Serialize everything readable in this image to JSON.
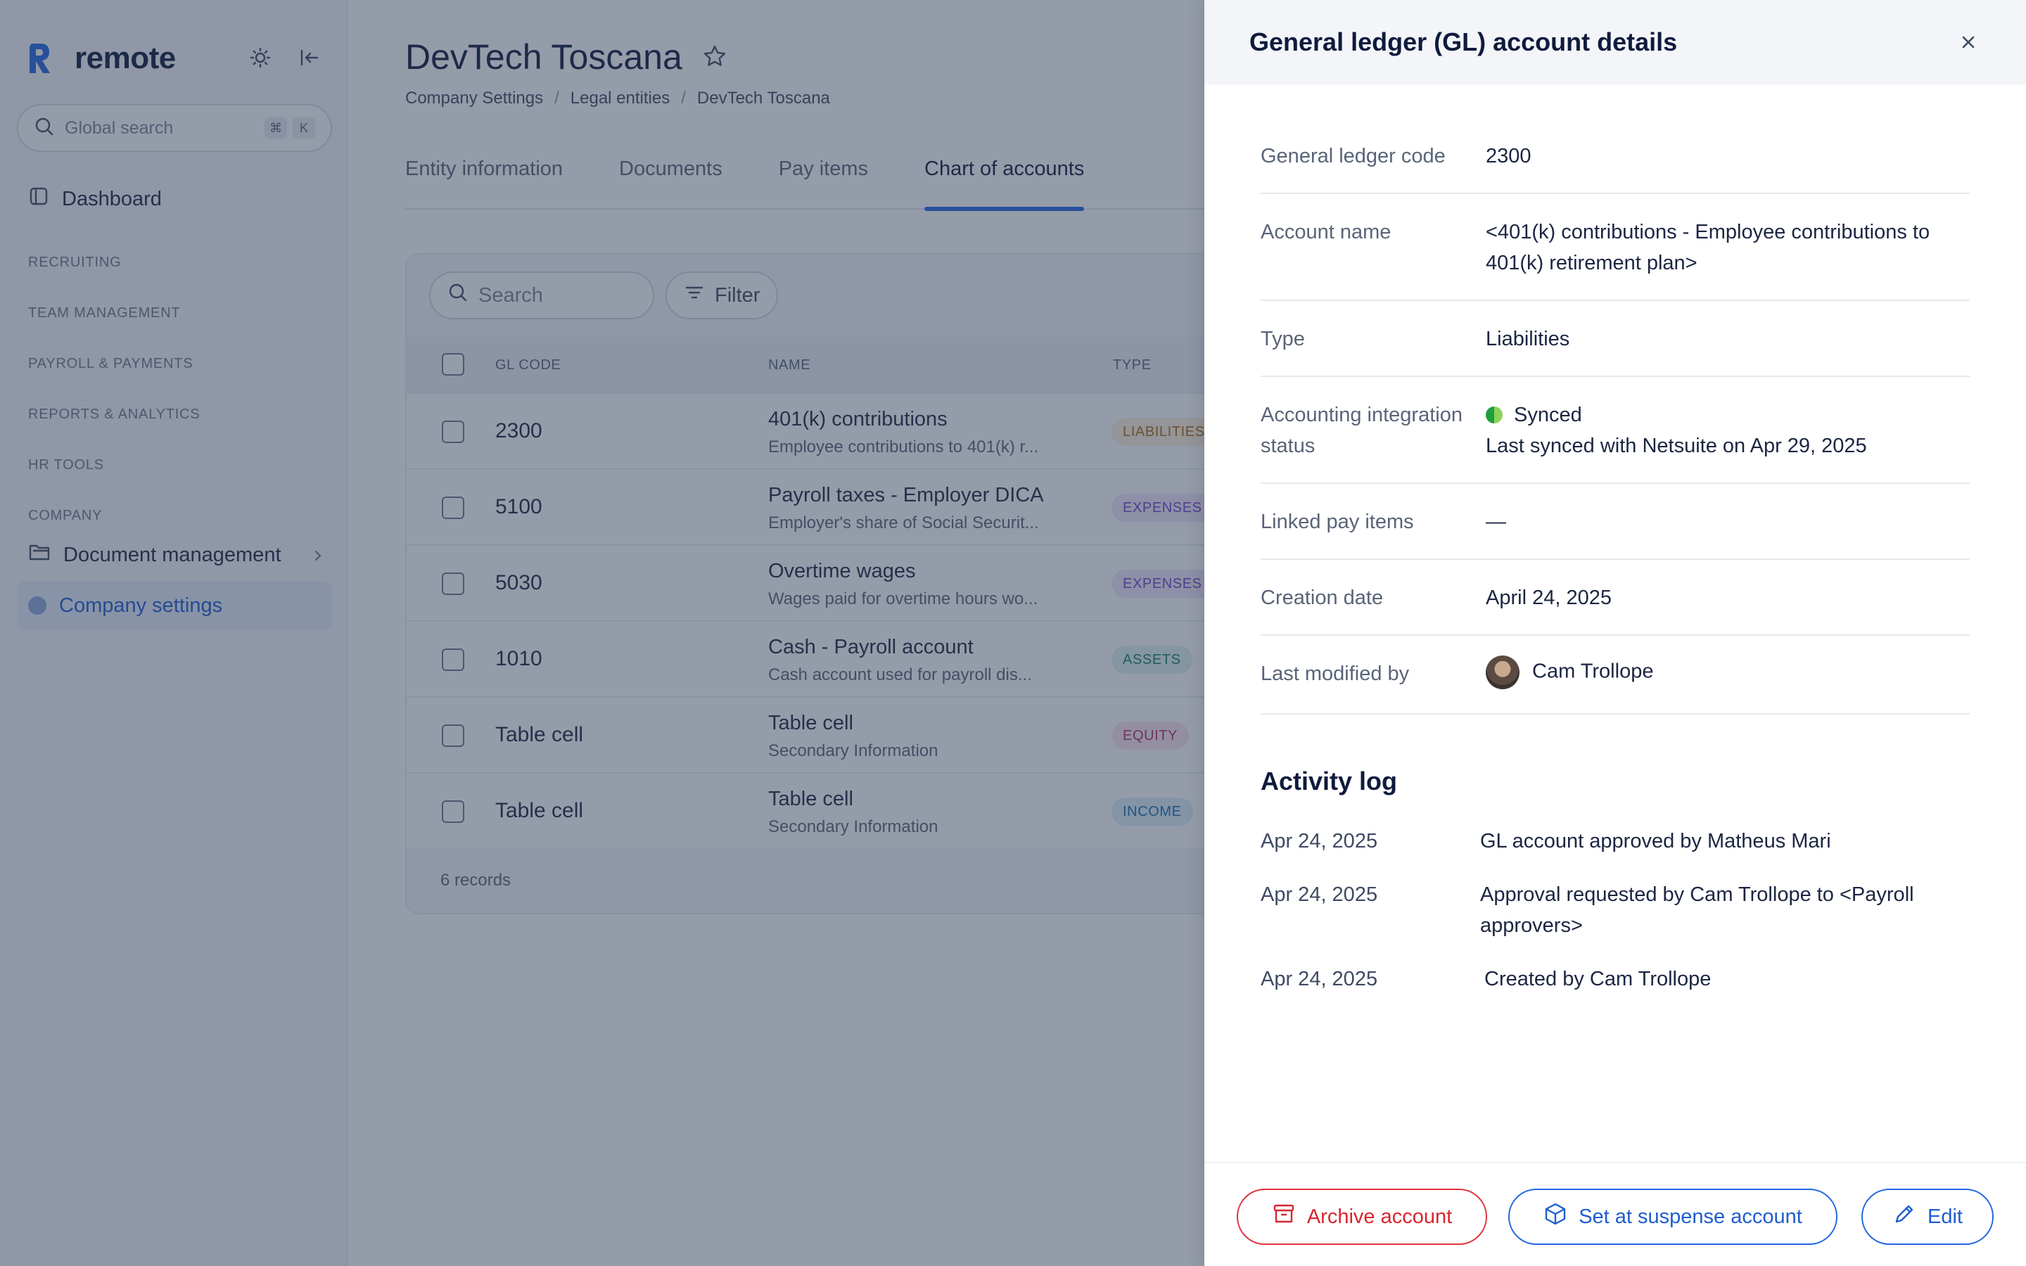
{
  "sidebar": {
    "brand": "remote",
    "search_placeholder": "Global search",
    "search_kbd": [
      "⌘",
      "K"
    ],
    "dashboard": "Dashboard",
    "sections": [
      "RECRUITING",
      "TEAM MANAGEMENT",
      "PAYROLL & PAYMENTS",
      "REPORTS & ANALYTICS",
      "HR TOOLS",
      "COMPANY"
    ],
    "document_management": "Document management",
    "company_settings": "Company settings"
  },
  "page": {
    "title": "DevTech Toscana",
    "breadcrumb": [
      "Company Settings",
      "Legal entities",
      "DevTech Toscana"
    ],
    "breadcrumb_sep": "/",
    "tabs": [
      "Entity information",
      "Documents",
      "Pay items",
      "Chart of accounts"
    ],
    "active_tab": "Chart of accounts"
  },
  "table": {
    "search_placeholder": "Search",
    "filter_label": "Filter",
    "columns": [
      "GL CODE",
      "NAME",
      "TYPE"
    ],
    "rows": [
      {
        "code": "2300",
        "name": "401(k) contributions",
        "sub": "Employee contributions to 401(k) r...",
        "type": "LIABILITIES"
      },
      {
        "code": "5100",
        "name": "Payroll taxes - Employer DICA",
        "sub": "Employer's share of Social Securit...",
        "type": "EXPENSES"
      },
      {
        "code": "5030",
        "name": "Overtime wages",
        "sub": "Wages paid for overtime hours wo...",
        "type": "EXPENSES"
      },
      {
        "code": "1010",
        "name": "Cash - Payroll account",
        "sub": "Cash account used for payroll dis...",
        "type": "ASSETS"
      },
      {
        "code": "Table cell",
        "name": "Table cell",
        "sub": "Secondary Information",
        "type": "EQUITY"
      },
      {
        "code": "Table cell",
        "name": "Table cell",
        "sub": "Secondary Information",
        "type": "INCOME"
      }
    ],
    "records": "6 records"
  },
  "drawer": {
    "title": "General ledger (GL) account details",
    "fields": {
      "code_label": "General ledger code",
      "code_value": "2300",
      "name_label": "Account name",
      "name_value": "<401(k) contributions - Employee contributions to 401(k) retirement plan>",
      "type_label": "Type",
      "type_value": "Liabilities",
      "integration_label": "Accounting integration status",
      "integration_status": "Synced",
      "integration_detail": "Last synced with Netsuite on Apr 29, 2025",
      "linked_label": "Linked pay items",
      "linked_value": "—",
      "creation_label": "Creation date",
      "creation_value": "April 24, 2025",
      "modified_label": "Last modified by",
      "modified_value": "Cam Trollope"
    },
    "activity_title": "Activity log",
    "activity": [
      {
        "date": "Apr 24, 2025",
        "text": "GL account approved by Matheus Mari"
      },
      {
        "date": "Apr 24, 2025",
        "text": "Approval requested by Cam Trollope to <Payroll approvers>"
      },
      {
        "date": "Apr 24, 2025",
        "text": "Created by Cam Trollope"
      }
    ],
    "buttons": {
      "archive": "Archive account",
      "suspense": "Set at suspense account",
      "edit": "Edit"
    }
  },
  "colors": {
    "accent": "#2266e3",
    "danger": "#d7262f",
    "overlay": "rgba(44,58,84,0.5)"
  }
}
